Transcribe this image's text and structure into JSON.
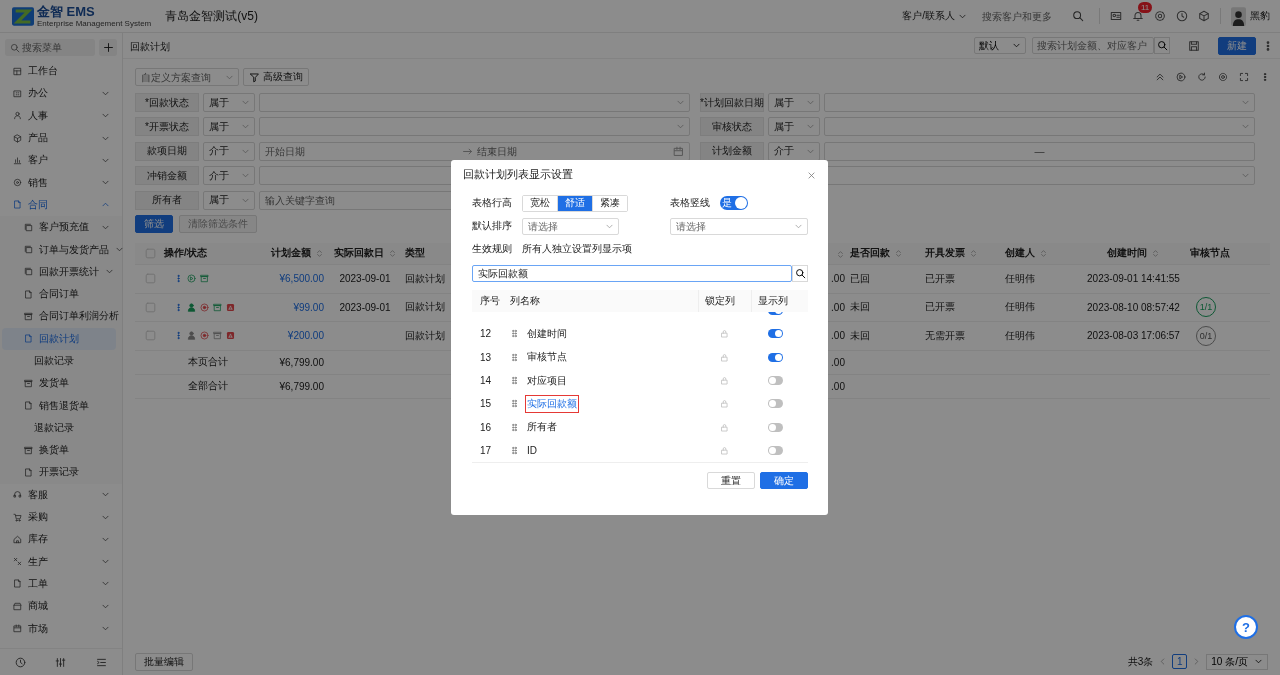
{
  "topbar": {
    "logo_name": "金智 EMS",
    "logo_subtitle": "Enterprise Management System",
    "title": "青岛金智测试(v5)",
    "scope_select": "客户/联系人",
    "search_placeholder": "搜索客户和更多",
    "notification_count": "11",
    "user_name": "黑豹"
  },
  "sidebar": {
    "search_placeholder": "搜索菜单",
    "items": [
      {
        "label": "工作台",
        "selected": false
      },
      {
        "label": "办公",
        "selected": false,
        "expanded": false
      },
      {
        "label": "人事",
        "selected": false,
        "expanded": false
      },
      {
        "label": "产品",
        "selected": false,
        "expanded": false
      },
      {
        "label": "客户",
        "selected": false,
        "expanded": false
      },
      {
        "label": "销售",
        "selected": false,
        "expanded": false
      },
      {
        "label": "合同",
        "selected": true,
        "expanded": true,
        "children": [
          {
            "label": "客户预充值",
            "kind": "page",
            "selected": false,
            "expanded": false
          },
          {
            "label": "订单与发货产品",
            "kind": "page",
            "selected": false,
            "expanded": false
          },
          {
            "label": "回款开票统计",
            "kind": "page",
            "selected": false,
            "expanded": false
          },
          {
            "label": "合同订单",
            "kind": "page",
            "selected": false
          },
          {
            "label": "合同订单利润分析",
            "kind": "page",
            "selected": false
          },
          {
            "label": "回款计划",
            "kind": "page",
            "selected": true
          },
          {
            "label": "回款记录",
            "kind": "plain",
            "selected": false
          },
          {
            "label": "发货单",
            "kind": "page",
            "selected": false
          },
          {
            "label": "销售退货单",
            "kind": "page",
            "selected": false
          },
          {
            "label": "退款记录",
            "kind": "plain",
            "selected": false
          },
          {
            "label": "换货单",
            "kind": "page",
            "selected": false
          },
          {
            "label": "开票记录",
            "kind": "page",
            "selected": false
          }
        ]
      },
      {
        "label": "客服",
        "selected": false,
        "expanded": false
      },
      {
        "label": "采购",
        "selected": false,
        "expanded": false
      },
      {
        "label": "库存",
        "selected": false,
        "expanded": false
      },
      {
        "label": "生产",
        "selected": false,
        "expanded": false
      },
      {
        "label": "工单",
        "selected": false,
        "expanded": false
      },
      {
        "label": "商城",
        "selected": false,
        "expanded": false
      },
      {
        "label": "市场",
        "selected": false,
        "expanded": false
      }
    ]
  },
  "page": {
    "title": "回款计划",
    "view_select": "默认",
    "search_placeholder": "搜索计划金额、对应客户",
    "new_button": "新建"
  },
  "filters": {
    "scheme_placeholder": "自定义方案查询",
    "advanced_button": "高级查询",
    "left": [
      {
        "label": "*回款状态",
        "operator": "属于",
        "kind": "select"
      },
      {
        "label": "*开票状态",
        "operator": "属于",
        "kind": "select"
      },
      {
        "label": "款项日期",
        "operator": "介于",
        "kind": "date-range",
        "from_placeholder": "开始日期",
        "to_placeholder": "结束日期"
      },
      {
        "label": "冲销金额",
        "operator": "介于",
        "kind": "text"
      },
      {
        "label": "所有者",
        "operator": "属于",
        "kind": "text",
        "placeholder": "输入关键字查询"
      }
    ],
    "right": [
      {
        "label": "*计划回款日期",
        "operator": "属于",
        "kind": "select"
      },
      {
        "label": "审核状态",
        "operator": "属于",
        "kind": "select"
      },
      {
        "label": "计划金额",
        "operator": "介于",
        "kind": "number-range",
        "separator": "—"
      },
      {
        "kind": "select"
      }
    ],
    "apply_button": "筛选",
    "clear_button": {
      "label": "清除筛选条件",
      "disabled": true
    }
  },
  "table": {
    "columns": [
      {
        "kind": "checkbox",
        "sortable": false
      },
      {
        "kind": "actions",
        "label": "操作/状态",
        "sortable": false
      },
      {
        "kind": "text",
        "label": "计划金额",
        "sortable": true
      },
      {
        "kind": "text",
        "label": "实际回款日",
        "sortable": true
      },
      {
        "kind": "text",
        "label": "类型",
        "sortable": false
      },
      {
        "kind": "text",
        "sortable": true
      },
      {
        "kind": "text",
        "label": "是否回款",
        "sortable": true
      },
      {
        "kind": "text",
        "label": "开具发票",
        "sortable": true
      },
      {
        "kind": "text",
        "label": "创建人",
        "sortable": true
      },
      {
        "kind": "text",
        "label": "创建时间",
        "sortable": true
      },
      {
        "kind": "approval",
        "label": "审核节点",
        "sortable": false
      }
    ],
    "rows": [
      {
        "kind": "data",
        "checked": false,
        "actions": [
          {
            "kind": "dots",
            "active": true
          },
          {
            "kind": "play",
            "active": true
          },
          {
            "kind": "box",
            "active": true
          }
        ],
        "planned_amount": "¥6,500.00",
        "actual_date": "2023-09-01",
        "type": "回款计划",
        "column_6": ".00",
        "returned": "已回",
        "invoice": "已开票",
        "creator": "任明伟",
        "created_at": "2023-09-01 14:41:55"
      },
      {
        "kind": "data",
        "checked": false,
        "actions": [
          {
            "kind": "dots",
            "active": true
          },
          {
            "kind": "person",
            "active": true
          },
          {
            "kind": "circle",
            "active": true
          },
          {
            "kind": "box",
            "active": true
          },
          {
            "kind": "tag",
            "active": true
          }
        ],
        "planned_amount": "¥99.00",
        "actual_date": "2023-09-01",
        "type": "回款计划",
        "column_6": ".00",
        "returned": "未回",
        "invoice": "已开票",
        "creator": "任明伟",
        "created_at": "2023-08-10 08:57:42",
        "approval": {
          "text": "1/1",
          "done": true
        }
      },
      {
        "kind": "data",
        "checked": false,
        "actions": [
          {
            "kind": "dots",
            "active": true
          },
          {
            "kind": "person",
            "active": false
          },
          {
            "kind": "circle",
            "active": true
          },
          {
            "kind": "box",
            "active": false
          },
          {
            "kind": "tag",
            "active": true
          }
        ],
        "planned_amount": "¥200.00",
        "type": "回款计划",
        "column_6": ".00",
        "returned": "未回",
        "invoice": "无需开票",
        "creator": "任明伟",
        "created_at": "2023-08-03 17:06:57",
        "approval": {
          "text": "0/1",
          "done": false
        }
      },
      {
        "kind": "total",
        "label": "本页合计",
        "planned_amount": "¥6,799.00",
        "column_6": ".00"
      },
      {
        "kind": "total",
        "label": "全部合计",
        "planned_amount": "¥6,799.00",
        "column_6": ".00"
      }
    ]
  },
  "footer": {
    "batch_button": "批量编辑",
    "total": "共3条",
    "pages": [
      {
        "label": "1",
        "selected": true
      }
    ],
    "page_size": "10 条/页"
  },
  "help_button": "?",
  "modal": {
    "title": "回款计划列表显示设置",
    "row_height": {
      "label": "表格行高",
      "options": [
        {
          "label": "宽松",
          "selected": false
        },
        {
          "label": "舒适",
          "selected": true
        },
        {
          "label": "紧凑",
          "selected": false
        }
      ]
    },
    "vertical_lines": {
      "label": "表格竖线",
      "on": true,
      "text": "是"
    },
    "default_sort": {
      "label": "默认排序",
      "placeholder": "请选择",
      "second_placeholder": "请选择"
    },
    "rule": {
      "label": "生效规则",
      "value": "所有人独立设置列显示项"
    },
    "search_value": "实际回款额",
    "header": {
      "index": "序号",
      "name": "列名称",
      "lock": "锁定列",
      "visible": "显示列"
    },
    "items": [
      {
        "visible": true
      },
      {
        "index": "12",
        "name": "创建时间",
        "visible": true,
        "matched": false
      },
      {
        "index": "13",
        "name": "审核节点",
        "visible": true,
        "matched": false
      },
      {
        "index": "14",
        "name": "对应项目",
        "visible": false,
        "matched": false
      },
      {
        "index": "15",
        "name": "实际回款额",
        "visible": false,
        "matched": true
      },
      {
        "index": "16",
        "name": "所有者",
        "visible": false,
        "matched": false
      },
      {
        "index": "17",
        "name": "ID",
        "visible": false,
        "matched": false
      }
    ],
    "reset_button": "重置",
    "confirm_button": "确定"
  }
}
